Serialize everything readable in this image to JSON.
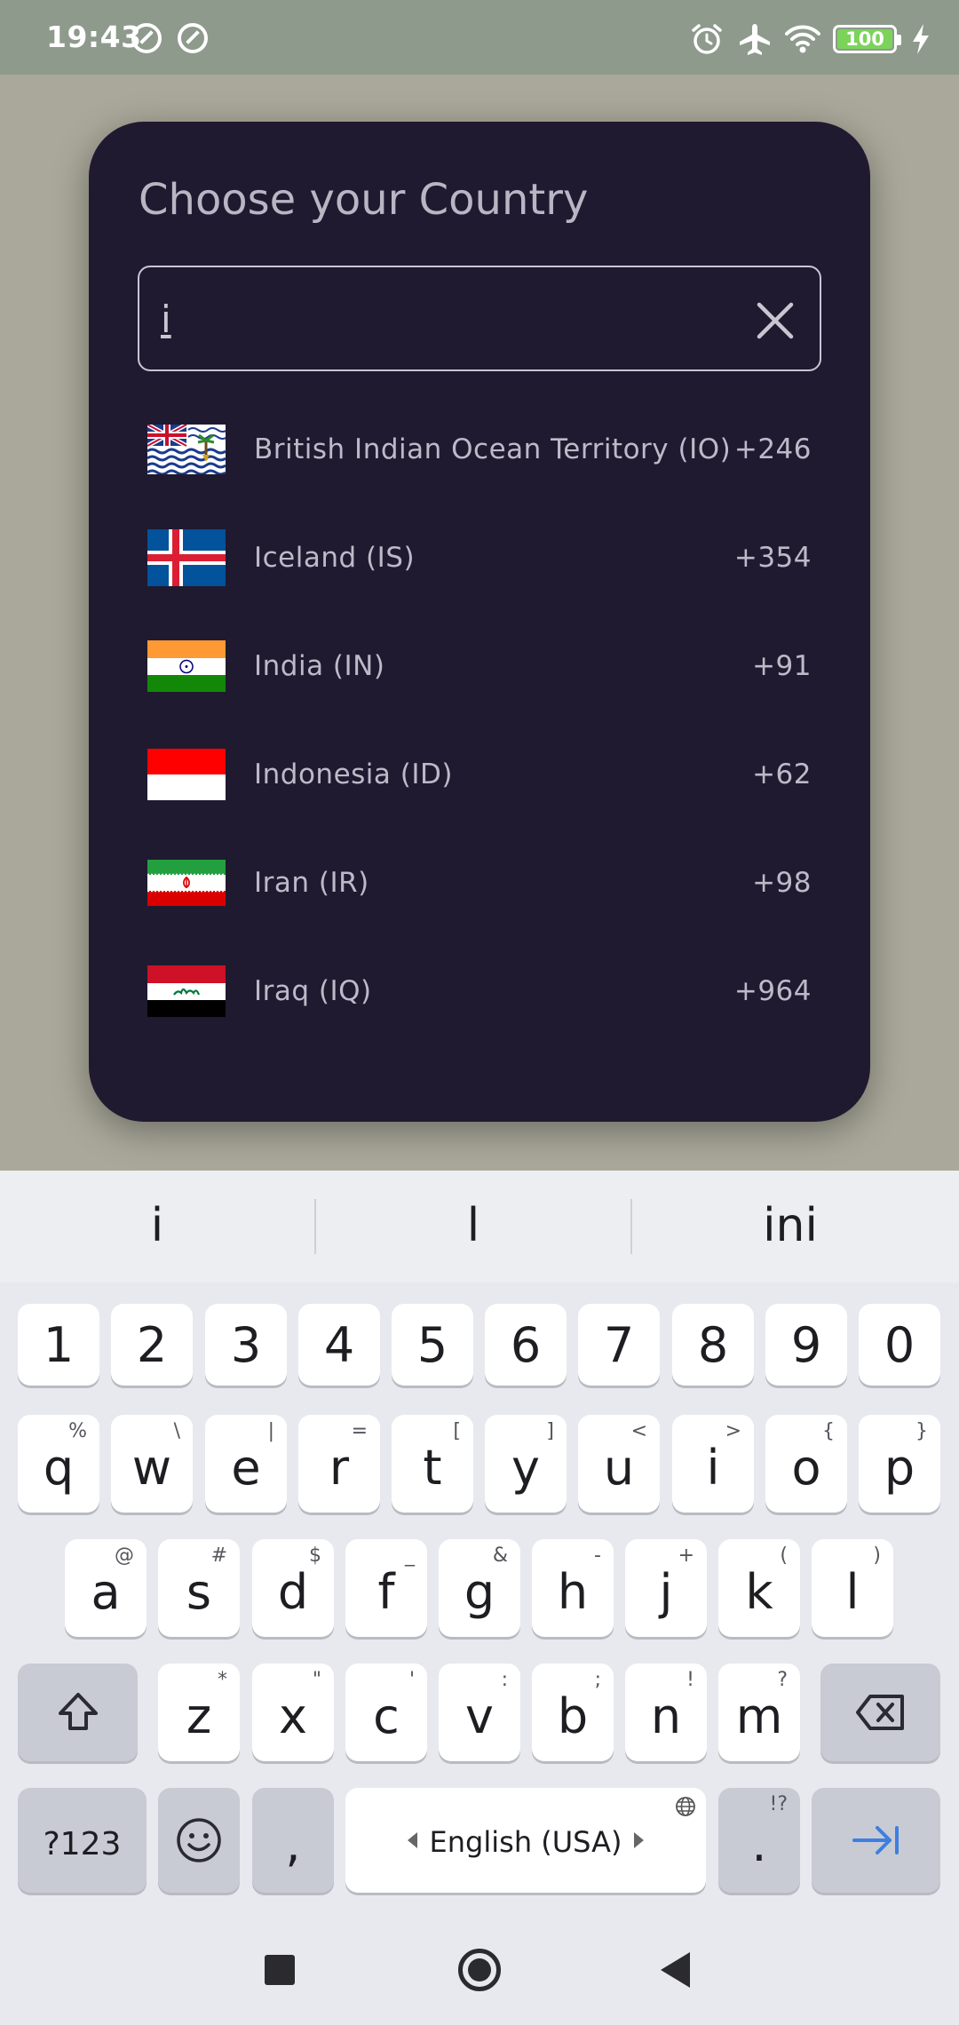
{
  "status_bar": {
    "time": "19:43",
    "left_icons": [
      "sync-icon",
      "sync-icon"
    ],
    "right_icons": [
      "alarm-icon",
      "airplane-icon",
      "wifi-icon",
      "battery-icon",
      "charging-icon"
    ],
    "battery_level": "100",
    "battery_color": "#7cd35a"
  },
  "dialog": {
    "title": "Choose your Country",
    "search": {
      "value": "i",
      "placeholder": ""
    },
    "countries": [
      {
        "name": "British Indian Ocean Territory (IO)",
        "code": "+246",
        "flag": "io"
      },
      {
        "name": "Iceland (IS)",
        "code": "+354",
        "flag": "is"
      },
      {
        "name": "India (IN)",
        "code": "+91",
        "flag": "in"
      },
      {
        "name": "Indonesia (ID)",
        "code": "+62",
        "flag": "id"
      },
      {
        "name": "Iran (IR)",
        "code": "+98",
        "flag": "ir"
      },
      {
        "name": "Iraq (IQ)",
        "code": "+964",
        "flag": "iq"
      }
    ],
    "background": "#1f1a30"
  },
  "keyboard": {
    "suggestions": [
      "i",
      "l",
      "ini"
    ],
    "number_row": [
      "1",
      "2",
      "3",
      "4",
      "5",
      "6",
      "7",
      "8",
      "9",
      "0"
    ],
    "row1": [
      {
        "k": "q",
        "h": "%"
      },
      {
        "k": "w",
        "h": "\\"
      },
      {
        "k": "e",
        "h": "|"
      },
      {
        "k": "r",
        "h": "="
      },
      {
        "k": "t",
        "h": "["
      },
      {
        "k": "y",
        "h": "]"
      },
      {
        "k": "u",
        "h": "<"
      },
      {
        "k": "i",
        "h": ">"
      },
      {
        "k": "o",
        "h": "{"
      },
      {
        "k": "p",
        "h": "}"
      }
    ],
    "row2": [
      {
        "k": "a",
        "h": "@"
      },
      {
        "k": "s",
        "h": "#"
      },
      {
        "k": "d",
        "h": "$"
      },
      {
        "k": "f",
        "h": "_"
      },
      {
        "k": "g",
        "h": "&"
      },
      {
        "k": "h",
        "h": "-"
      },
      {
        "k": "j",
        "h": "+"
      },
      {
        "k": "k",
        "h": "("
      },
      {
        "k": "l",
        "h": ")"
      }
    ],
    "row3": [
      {
        "k": "z",
        "h": "*"
      },
      {
        "k": "x",
        "h": "\""
      },
      {
        "k": "c",
        "h": "'"
      },
      {
        "k": "v",
        "h": ":"
      },
      {
        "k": "b",
        "h": ";"
      },
      {
        "k": "n",
        "h": "!"
      },
      {
        "k": "m",
        "h": "?"
      }
    ],
    "symbols_label": "?123",
    "comma_label": ",",
    "space_label": "English (USA)",
    "period_label": ".",
    "period_hint": "!?",
    "accent_color": "#3d7fe0"
  },
  "nav_bar": {
    "buttons": [
      "recents-button",
      "home-button",
      "back-button"
    ]
  }
}
